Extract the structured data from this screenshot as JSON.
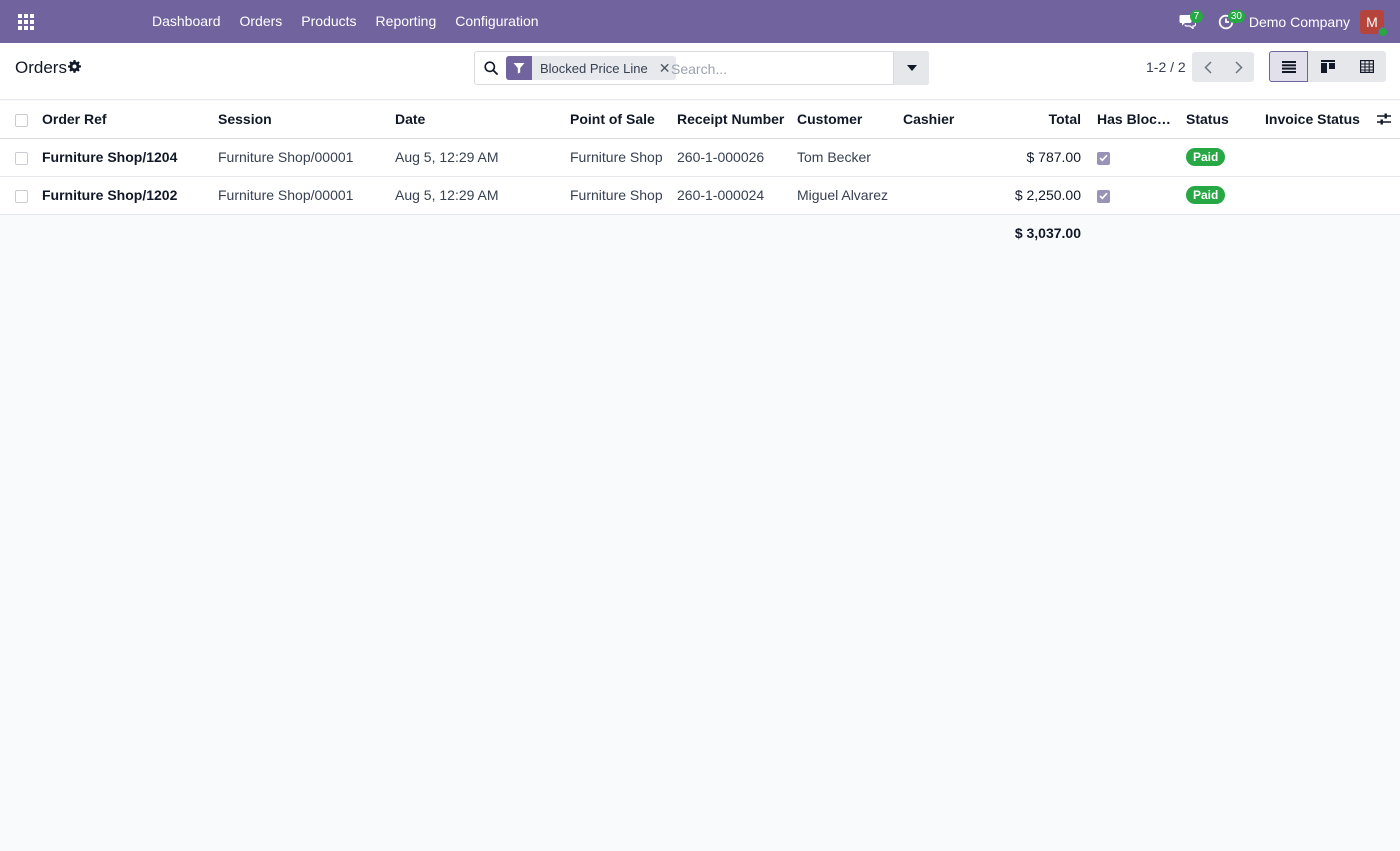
{
  "navbar": {
    "menu": [
      "Dashboard",
      "Orders",
      "Products",
      "Reporting",
      "Configuration"
    ],
    "messages_count": "7",
    "activities_count": "30",
    "company": "Demo Company",
    "avatar_initial": "M"
  },
  "control_panel": {
    "title": "Orders",
    "facet_label": "Blocked Price Line",
    "search_placeholder": "Search...",
    "pager": "1-2 / 2"
  },
  "table": {
    "columns": [
      "Order Ref",
      "Session",
      "Date",
      "Point of Sale",
      "Receipt Number",
      "Customer",
      "Cashier",
      "Total",
      "Has Blocke...",
      "Status",
      "Invoice Status"
    ],
    "rows": [
      {
        "order_ref": "Furniture Shop/1204",
        "session": "Furniture Shop/00001",
        "date": "Aug 5, 12:29 AM",
        "pos": "Furniture Shop",
        "receipt": "260-1-000026",
        "customer": "Tom Becker",
        "cashier": "",
        "total": "$ 787.00",
        "has_blocked": true,
        "status": "Paid",
        "invoice_status": ""
      },
      {
        "order_ref": "Furniture Shop/1202",
        "session": "Furniture Shop/00001",
        "date": "Aug 5, 12:29 AM",
        "pos": "Furniture Shop",
        "receipt": "260-1-000024",
        "customer": "Miguel Alvarez",
        "cashier": "",
        "total": "$ 2,250.00",
        "has_blocked": true,
        "status": "Paid",
        "invoice_status": ""
      }
    ],
    "footer_total": "$ 3,037.00"
  },
  "colors": {
    "brand": "#71639e",
    "status_paid": "#28a745",
    "avatar": "#b5453c"
  }
}
